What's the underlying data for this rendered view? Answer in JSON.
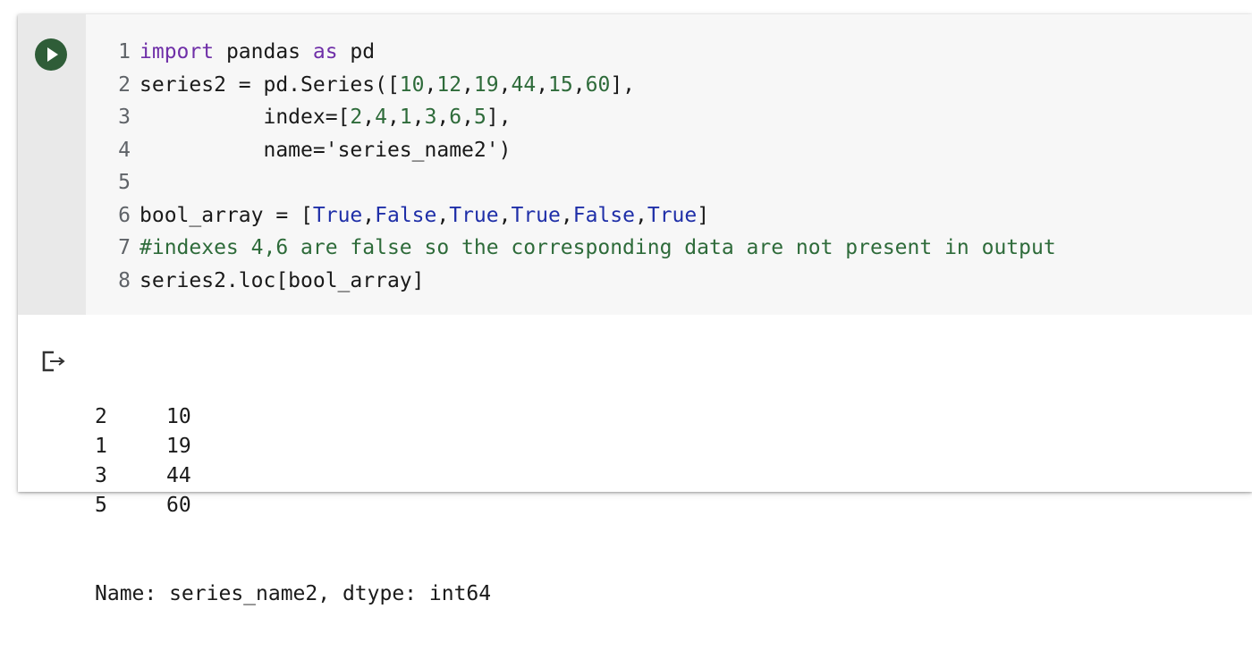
{
  "cell": {
    "run_button": "run-cell",
    "code_lines": [
      {
        "num": "1",
        "tokens": [
          {
            "t": "import",
            "c": "kw"
          },
          {
            "t": " pandas ",
            "c": ""
          },
          {
            "t": "as",
            "c": "kw"
          },
          {
            "t": " pd",
            "c": ""
          }
        ]
      },
      {
        "num": "2",
        "tokens": [
          {
            "t": "series2 = pd.Series([",
            "c": ""
          },
          {
            "t": "10",
            "c": "num"
          },
          {
            "t": ",",
            "c": ""
          },
          {
            "t": "12",
            "c": "num"
          },
          {
            "t": ",",
            "c": ""
          },
          {
            "t": "19",
            "c": "num"
          },
          {
            "t": ",",
            "c": ""
          },
          {
            "t": "44",
            "c": "num"
          },
          {
            "t": ",",
            "c": ""
          },
          {
            "t": "15",
            "c": "num"
          },
          {
            "t": ",",
            "c": ""
          },
          {
            "t": "60",
            "c": "num"
          },
          {
            "t": "],",
            "c": ""
          }
        ]
      },
      {
        "num": "3",
        "tokens": [
          {
            "t": "          index=[",
            "c": ""
          },
          {
            "t": "2",
            "c": "num"
          },
          {
            "t": ",",
            "c": ""
          },
          {
            "t": "4",
            "c": "num"
          },
          {
            "t": ",",
            "c": ""
          },
          {
            "t": "1",
            "c": "num"
          },
          {
            "t": ",",
            "c": ""
          },
          {
            "t": "3",
            "c": "num"
          },
          {
            "t": ",",
            "c": ""
          },
          {
            "t": "6",
            "c": "num"
          },
          {
            "t": ",",
            "c": ""
          },
          {
            "t": "5",
            "c": "num"
          },
          {
            "t": "],",
            "c": ""
          }
        ]
      },
      {
        "num": "4",
        "tokens": [
          {
            "t": "          name=",
            "c": ""
          },
          {
            "t": "'series_name2'",
            "c": "str"
          },
          {
            "t": ")",
            "c": ""
          }
        ]
      },
      {
        "num": "5",
        "tokens": []
      },
      {
        "num": "6",
        "tokens": [
          {
            "t": "bool_array = [",
            "c": ""
          },
          {
            "t": "True",
            "c": "bool"
          },
          {
            "t": ",",
            "c": ""
          },
          {
            "t": "False",
            "c": "bool"
          },
          {
            "t": ",",
            "c": ""
          },
          {
            "t": "True",
            "c": "bool"
          },
          {
            "t": ",",
            "c": ""
          },
          {
            "t": "True",
            "c": "bool"
          },
          {
            "t": ",",
            "c": ""
          },
          {
            "t": "False",
            "c": "bool"
          },
          {
            "t": ",",
            "c": ""
          },
          {
            "t": "True",
            "c": "bool"
          },
          {
            "t": "]",
            "c": ""
          }
        ]
      },
      {
        "num": "7",
        "tokens": [
          {
            "t": "#indexes 4,6 are false so the corresponding data are not present in output",
            "c": "cmt"
          }
        ]
      },
      {
        "num": "8",
        "tokens": [
          {
            "t": "series2.loc[bool_array]",
            "c": ""
          }
        ]
      }
    ],
    "output": {
      "icon": "output-arrow-icon",
      "rows": [
        {
          "index": "2",
          "value": "10"
        },
        {
          "index": "1",
          "value": "19"
        },
        {
          "index": "3",
          "value": "44"
        },
        {
          "index": "5",
          "value": "60"
        }
      ],
      "footer": "Name: series_name2, dtype: int64"
    }
  },
  "colors": {
    "keyword": "#6f2fa8",
    "number": "#2e6b3a",
    "boolean": "#1f2fa8",
    "comment": "#2e6b3a",
    "run_button": "#2f5d38"
  }
}
